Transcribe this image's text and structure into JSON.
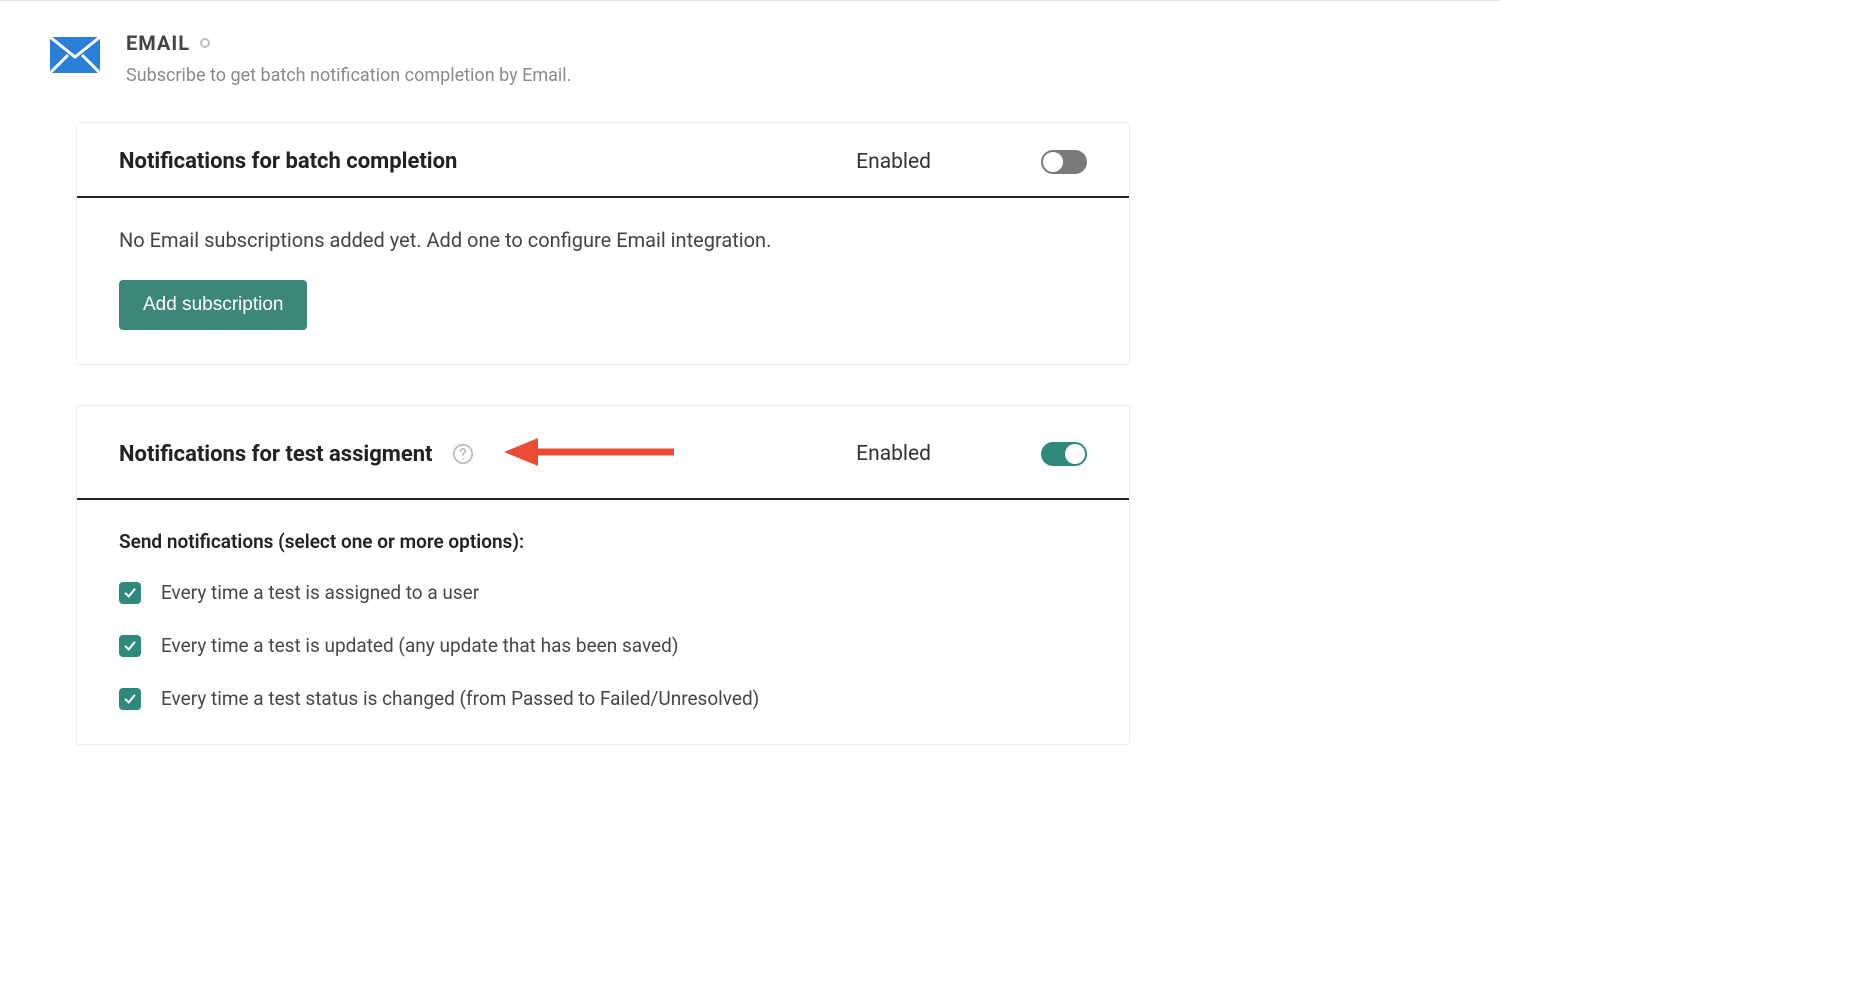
{
  "header": {
    "title": "EMAIL",
    "subtitle": "Subscribe to get batch notification completion by Email."
  },
  "card1": {
    "title": "Notifications for batch completion",
    "status_label": "Enabled",
    "toggle_on": false,
    "empty_message": "No Email subscriptions added yet. Add one to configure Email integration.",
    "add_button": "Add subscription"
  },
  "card2": {
    "title": "Notifications for test assigment",
    "status_label": "Enabled",
    "toggle_on": true,
    "options_title": "Send notifications (select one or more options):",
    "options": [
      {
        "label": "Every time a test is assigned to a user",
        "checked": true
      },
      {
        "label": "Every time a test is updated (any update that has been saved)",
        "checked": true
      },
      {
        "label": "Every time a test status is changed (from Passed to Failed/Unresolved)",
        "checked": true
      }
    ]
  },
  "colors": {
    "accent": "#2f8a7b",
    "arrow": "#e94b35"
  }
}
